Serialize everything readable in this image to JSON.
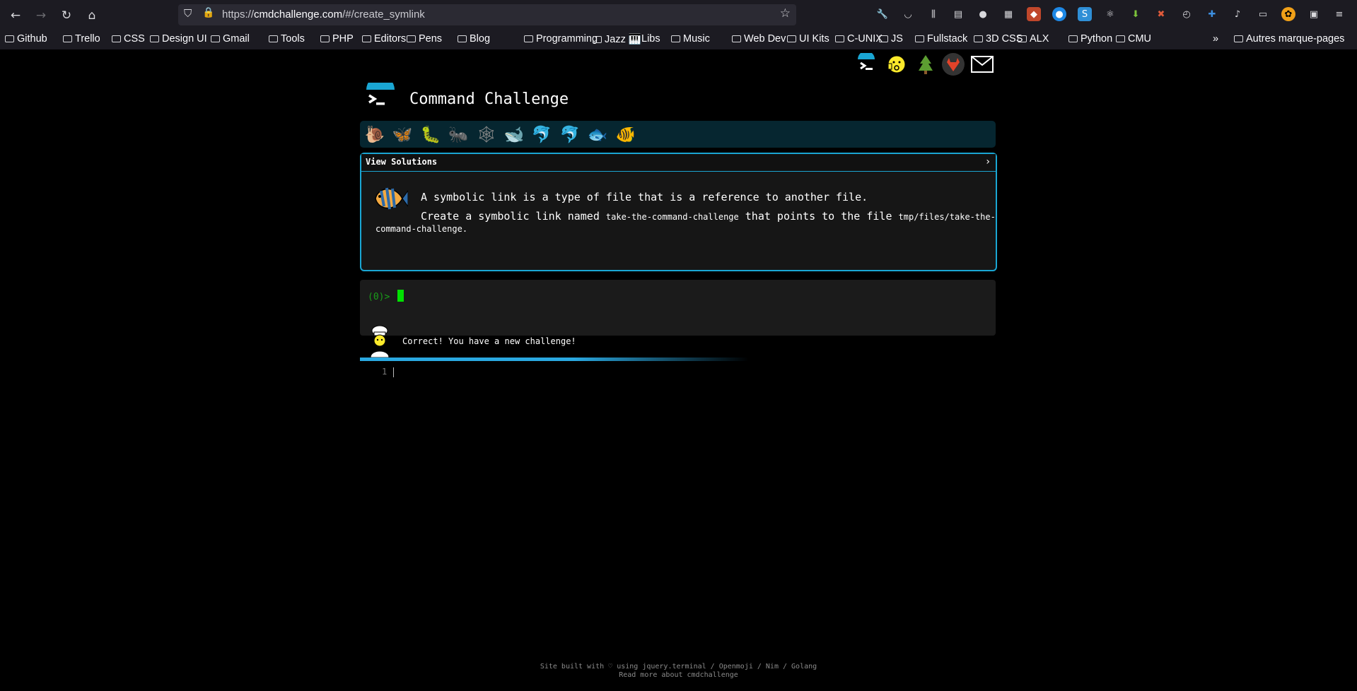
{
  "browser": {
    "url_scheme": "https://",
    "url_host": "cmdchallenge.com",
    "url_path": "/#/create_symlink",
    "bookmarks": [
      "Github",
      "Trello",
      "CSS",
      "Design UI",
      "Gmail",
      "Tools",
      "PHP",
      "Editors",
      "Pens",
      "Blog",
      "Programming",
      "Jazz 🎹",
      "Libs",
      "Music",
      "Web Dev",
      "UI Kits",
      "C-UNIX",
      "JS",
      "Fullstack",
      "3D CSS",
      "ALX",
      "Python",
      "CMU"
    ],
    "bookmarks_more": "»",
    "other_bookmarks": "Autres marque-pages"
  },
  "site": {
    "title": "Command Challenge",
    "top_icons": [
      "terminal-icon",
      "face-icon",
      "tree-icon",
      "gitlab-icon",
      "mail-icon"
    ],
    "levels": [
      "snail-icon",
      "butterfly-icon",
      "caterpillar-icon",
      "ant-icon",
      "web-icon",
      "whale-icon",
      "dolphin-icon",
      "dolphin2-icon",
      "fish-icon",
      "tropical-fish-icon"
    ]
  },
  "challenge": {
    "view_solutions": "View Solutions",
    "chevron": "›",
    "line1": "A symbolic link is a type of file that is a reference to another file.",
    "line2_a": "Create a symbolic link named ",
    "line2_code1": "take-the-command-challenge",
    "line2_b": " that points to the file ",
    "line2_code2a": "tmp/files/take-the-",
    "line2_code2b": "command-challenge",
    "line2_end": "."
  },
  "terminal": {
    "prompt": "(0)>"
  },
  "feedback": {
    "message": "Correct! You have a new challenge!"
  },
  "editor": {
    "line_number": "1"
  },
  "footer": {
    "line1": "Site built with ♡ using jquery.terminal / Openmoji / Nim / Golang",
    "line2": "Read more about cmdchallenge"
  },
  "colors": {
    "accent": "#1aa6d3",
    "terminal_green": "#00e000"
  }
}
